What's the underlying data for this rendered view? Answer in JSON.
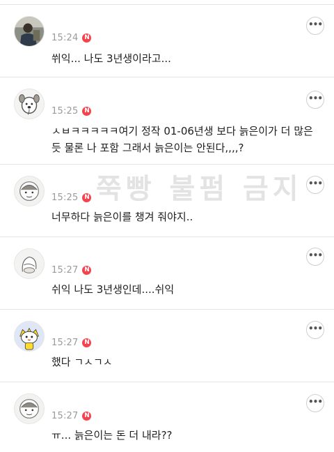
{
  "comments": [
    {
      "time": "15:24",
      "badge": "N",
      "text": "쒸익... 나도 3년생이라고...",
      "avatar": "photo-avatar"
    },
    {
      "time": "15:25",
      "badge": "N",
      "text": "ㅅㅂㅋㅋㅋㅋㅋ여기 정작 01-06년생 보다 늙은이가 더 많은 듯 물론 나 포함 그래서 늙은이는 안된다,,,,?",
      "avatar": "dog-avatar"
    },
    {
      "time": "15:25",
      "badge": "N",
      "text": "너무하다 늙은이를 챙겨 줘야지..",
      "avatar": "face-avatar"
    },
    {
      "time": "15:27",
      "badge": "N",
      "text": "쉬익 나도 3년생인데....쉬익",
      "avatar": "sketch-avatar"
    },
    {
      "time": "15:27",
      "badge": "N",
      "text": "했다 ㄱㅅㄱㅅ",
      "avatar": "yellow-character-avatar"
    },
    {
      "time": "15:27",
      "badge": "N",
      "text": "ㅠ... 늙은이는 돈 더 내라??",
      "avatar": "face-avatar"
    }
  ],
  "more_label": "•••",
  "watermark": "쭉빵 불펌 금지",
  "colors": {
    "badge": "#f4434d",
    "time": "#9a9a9a",
    "divider": "#e6e6e6"
  }
}
